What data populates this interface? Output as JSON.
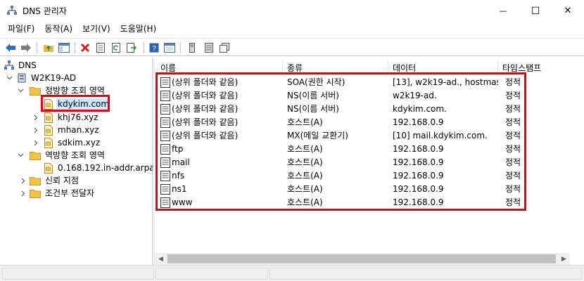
{
  "window": {
    "title": "DNS 관리자",
    "minimize_glyph": "—",
    "maximize_glyph": "☐",
    "close_glyph": "✕"
  },
  "menu": {
    "items": [
      "파일(F)",
      "동작(A)",
      "보기(V)",
      "도움말(H)"
    ]
  },
  "toolbar": {
    "icons": [
      "back-arrow-icon",
      "forward-arrow-icon",
      "up-folder-icon",
      "show-tree-icon",
      "delete-icon",
      "properties-icon",
      "refresh-icon",
      "export-icon",
      "help-icon",
      "console-icon",
      "server-icon",
      "list-icon",
      "copy-icon"
    ]
  },
  "tree": {
    "root": "DNS",
    "server": "W2K19-AD",
    "forward_zones": "정방향 조회 영역",
    "zones": [
      "kdykim.com",
      "khj76.xyz",
      "mhan.xyz",
      "sdkim.xyz"
    ],
    "reverse_zones": "역방향 조회 영역",
    "reverse_zone": "0.168.192.in-addr.arpa",
    "trust_points": "신뢰 지점",
    "conditional_forwarders": "조건부 전달자"
  },
  "list": {
    "columns": [
      "이름",
      "종류",
      "데이터",
      "타임스탬프"
    ],
    "rows": [
      {
        "name": "(상위 폴더와 같음)",
        "type": "SOA(권한 시작)",
        "data": "[13], w2k19-ad., hostmas...",
        "timestamp": "정적"
      },
      {
        "name": "(상위 폴더와 같음)",
        "type": "NS(이름 서버)",
        "data": "w2k19-ad.",
        "timestamp": "정적"
      },
      {
        "name": "(상위 폴더와 같음)",
        "type": "NS(이름 서버)",
        "data": "kdykim.com.",
        "timestamp": "정적"
      },
      {
        "name": "(상위 폴더와 같음)",
        "type": "호스트(A)",
        "data": "192.168.0.9",
        "timestamp": "정적"
      },
      {
        "name": "(상위 폴더와 같음)",
        "type": "MX(메일 교환기)",
        "data": "[10]  mail.kdykim.com.",
        "timestamp": "정적"
      },
      {
        "name": "ftp",
        "type": "호스트(A)",
        "data": "192.168.0.9",
        "timestamp": "정적"
      },
      {
        "name": "mail",
        "type": "호스트(A)",
        "data": "192.168.0.9",
        "timestamp": "정적"
      },
      {
        "name": "nfs",
        "type": "호스트(A)",
        "data": "192.168.0.9",
        "timestamp": "정적"
      },
      {
        "name": "ns1",
        "type": "호스트(A)",
        "data": "192.168.0.9",
        "timestamp": "정적"
      },
      {
        "name": "www",
        "type": "호스트(A)",
        "data": "192.168.0.9",
        "timestamp": "정적"
      }
    ]
  },
  "colors": {
    "highlight": "#e8000b",
    "folder": "#f5c342",
    "selection": "#cce8ff"
  }
}
